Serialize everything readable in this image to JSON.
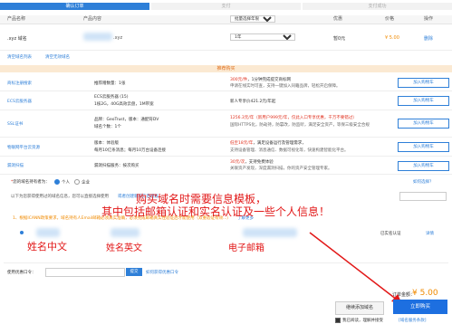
{
  "steps": [
    "确认订单",
    "支付",
    "支付成功"
  ],
  "header": {
    "name": "产品名称",
    "content": "产品内容",
    "period_select": "批量选择年限",
    "discount": "优惠",
    "price": "价格",
    "action": "操作"
  },
  "order_row": {
    "name": ".xyz 域名",
    "domain_suffix": ".xyz",
    "period": "1年",
    "discount": "暂0元",
    "price": "¥ 5.00",
    "delete": "删除"
  },
  "links": {
    "clear_all": "清空域名列表",
    "clear_invalid": "清空无效域名"
  },
  "recommend_title": "推荐购买",
  "products": [
    {
      "name": "商标注册搜索",
      "content": "推荐赠数量：1张",
      "promo_red": "300元/件",
      "promo_text": "，1分钟完成提交商标网",
      "desc": "申请在线实时可查，支持一键加入同籍品牌，轻松开启保障。",
      "button": "加入购物车"
    },
    {
      "name": "ECS云服务器",
      "content": "ECS云服务器 (15)",
      "content2": "1核2G，40G高效云盘，1M带宽",
      "promo_red": "",
      "promo_text": "新人专享价421.2元/年起",
      "desc": "",
      "button": "加入购物车"
    },
    {
      "name": "SSL证书",
      "content": "品牌：GeoTrust，版本：通配符DV",
      "content2": "域名个数：1个",
      "promo_red": "",
      "promo_text": "1256.3元/年（新用户999元/年，仅此入口专享优惠，千万不要错过）",
      "desc": "国际HTTPS化，防劫持，防篡改，防监听，满足安全资产，等保三级安全合规",
      "button": "加入购物车"
    },
    {
      "name": "物联网平台云资源",
      "content": "版本：体验版",
      "content2": "每月10亿条消息；每月10万台设备连接",
      "promo_red": "低至18元/年",
      "promo_text": "，满足设备运行及管理需求，",
      "desc": "支持设备管理、消息通信、数据可视化等，快速构建智能化平台。",
      "button": "加入购物车"
    },
    {
      "name": "漏洞扫描",
      "content": "漏洞扫描服务：按次购买",
      "content2": "",
      "promo_red": "30元/次",
      "promo_text": "，支持免费体验",
      "desc": "关联资产发现，深度漏洞扫描，你的资产安全管理专家。",
      "button": "加入购物车"
    }
  ],
  "owner": {
    "label": "您的域名持有者为：",
    "individual": "个人",
    "company": "企业",
    "template_link": "如何选择？",
    "info_line": "以下为您获得使用过的域名信息，您可以直接选择使用",
    "info_link": "或者创建新的信息模板",
    "template_placeholder": "",
    "notice": "1、根据ICANN政策要求，域名持有人Email邮箱必须真实准确，必须完成邮箱真实性验证后才能使用（双重验证有效...）",
    "notice_link": "了解更多",
    "status": "已实名认证",
    "detail": "详情"
  },
  "annotation": {
    "line1": "购买域名时需要信息模板，",
    "line2": "其中包括邮箱认证和实名认证及一些个人信息！",
    "name_cn": "姓名中文",
    "name_en": "姓名英文",
    "email": "电子邮箱"
  },
  "coupon": {
    "label": "使用优惠口令：",
    "button": "提交",
    "link": "如何获得优惠口令"
  },
  "total": {
    "label": "订单金额：",
    "amount": "¥ 5.00"
  },
  "buttons": {
    "continue": "继续添加域名",
    "buy": "立即购买"
  },
  "agree": {
    "text": "我已阅读，理解并接受",
    "link": "[域名服务条款]"
  },
  "colors": {
    "primary": "#2e7fd8",
    "annotation_red": "#e21818",
    "price_orange": "#f08a00"
  }
}
